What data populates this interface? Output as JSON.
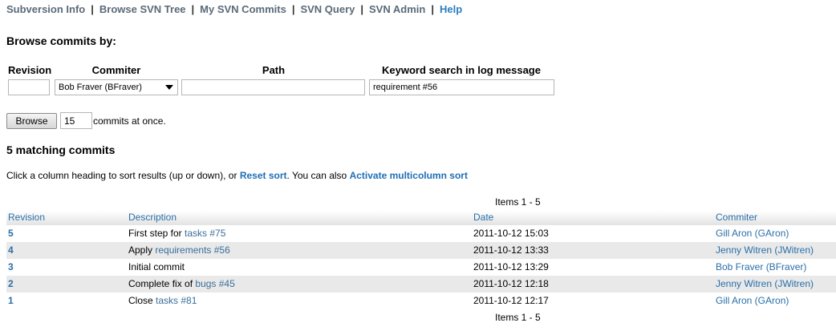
{
  "nav": {
    "items": [
      {
        "label": "Subversion Info"
      },
      {
        "label": "Browse SVN Tree"
      },
      {
        "label": "My SVN Commits"
      },
      {
        "label": "SVN Query"
      },
      {
        "label": "SVN Admin"
      },
      {
        "label": "Help"
      }
    ],
    "separator": "|"
  },
  "form": {
    "heading": "Browse commits by:",
    "labels": {
      "revision": "Revision",
      "commiter": "Commiter",
      "path": "Path",
      "keyword": "Keyword search in log message"
    },
    "revision_value": "",
    "commiter_selected": "Bob Fraver (BFraver)",
    "path_value": "",
    "keyword_value": "requirement #56",
    "browse_button": "Browse",
    "count_value": "15",
    "count_suffix": "commits at once."
  },
  "results": {
    "heading": "5 matching commits",
    "hint_prefix": "Click a column heading to sort results (up or down), or",
    "reset_sort": "Reset sort",
    "hint_middle": ". You can also",
    "multicolumn_sort": "Activate multicolumn sort",
    "pager_top": "Items 1 - 5",
    "pager_bottom": "Items 1 - 5",
    "columns": {
      "revision": "Revision",
      "description": "Description",
      "date": "Date",
      "commiter": "Commiter"
    },
    "rows": [
      {
        "revision": "5",
        "desc_prefix": "First step for",
        "desc_link": "tasks #75",
        "date": "2011-10-12 15:03",
        "commiter": "Gill Aron (GAron)"
      },
      {
        "revision": "4",
        "desc_prefix": "Apply",
        "desc_link": "requirements #56",
        "date": "2011-10-12 13:33",
        "commiter": "Jenny Witren (JWitren)"
      },
      {
        "revision": "3",
        "desc_prefix": "Initial commit",
        "desc_link": "",
        "date": "2011-10-12 13:29",
        "commiter": "Bob Fraver (BFraver)"
      },
      {
        "revision": "2",
        "desc_prefix": "Complete fix of",
        "desc_link": "bugs #45",
        "date": "2011-10-12 12:18",
        "commiter": "Jenny Witren (JWitren)"
      },
      {
        "revision": "1",
        "desc_prefix": "Close",
        "desc_link": "tasks #81",
        "date": "2011-10-12 12:17",
        "commiter": "Gill Aron (GAron)"
      }
    ]
  }
}
